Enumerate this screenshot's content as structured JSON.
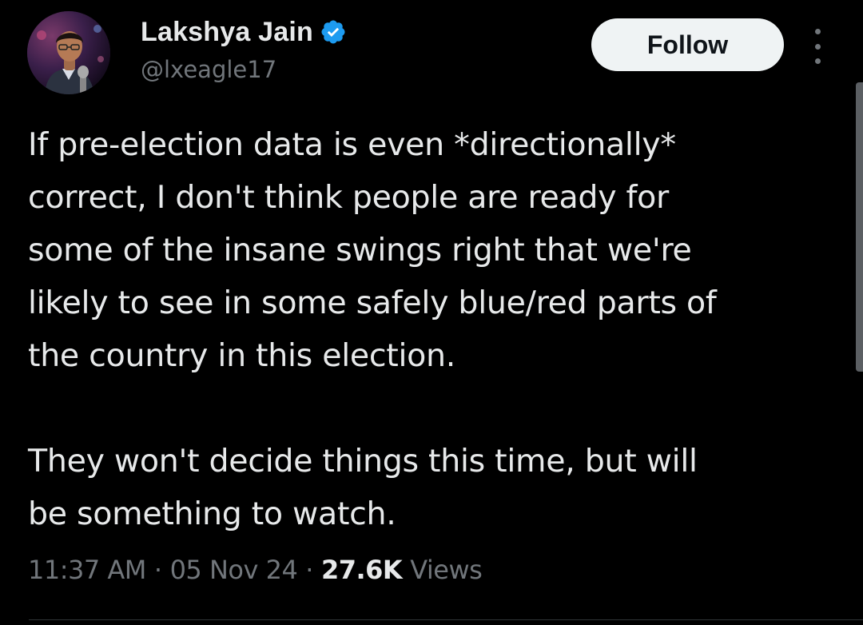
{
  "author": {
    "display_name": "Lakshya Jain",
    "handle": "@lxeagle17",
    "verified_icon": "verified-badge-icon"
  },
  "actions": {
    "follow_label": "Follow",
    "more_icon": "more-vertical-icon"
  },
  "tweet": {
    "text": "If pre-election data is even *directionally*\ncorrect, I don't think people are ready for\nsome of the insane swings right that we're\nlikely to see in some safely blue/red parts of\nthe country in this election.\n\nThey won't decide things this time, but will\nbe something to watch.",
    "time": "11:37 AM",
    "date": "05 Nov 24",
    "separator": "·",
    "views_count": "27.6K",
    "views_label": "Views"
  },
  "colors": {
    "background": "#000000",
    "primary_text": "#e7e9ea",
    "secondary_text": "#71767b",
    "verified_blue": "#1d9bf0",
    "follow_button_bg": "#eff3f4"
  }
}
